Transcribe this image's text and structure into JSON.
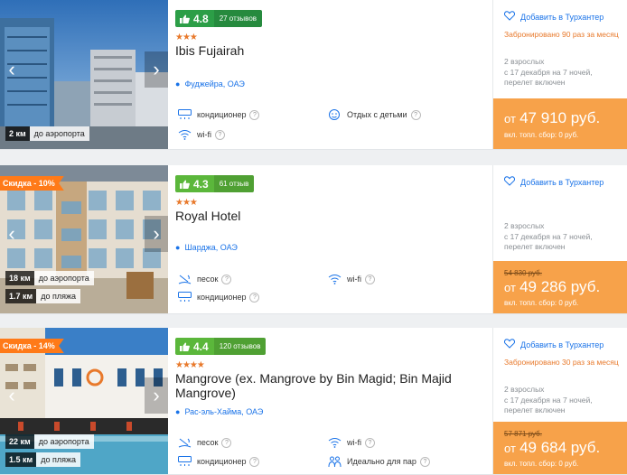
{
  "hotels": [
    {
      "rating": "4.8",
      "reviews": "27 отзывов",
      "stars": "★★★",
      "name": "Ibis Fujairah",
      "location": "Фуджейра, ОАЭ",
      "distances": [
        {
          "km": "2 км",
          "label": "до аэропорта"
        }
      ],
      "amenities": [
        {
          "icon": "air-conditioner-icon",
          "label": "кондиционер"
        },
        {
          "icon": "kids-icon",
          "label": "Отдых с детьми"
        },
        {
          "icon": "wifi-icon",
          "label": "wi-fi"
        }
      ],
      "favorite": "Добавить в Турхантер",
      "booked": "Забронировано 90 раз за месяц",
      "details": [
        "2 взрослых",
        "с 17 декабря на 7 ночей,",
        "перелет включен"
      ],
      "price_from": "от",
      "price": "47 910 руб.",
      "tax": "вкл. топл. сбор: 0 руб."
    },
    {
      "discount": "Скидка - 10%",
      "rating": "4.3",
      "reviews": "61 отзыв",
      "stars": "★★★",
      "name": "Royal Hotel",
      "location": "Шарджа, ОАЭ",
      "distances": [
        {
          "km": "18 км",
          "label": "до аэропорта"
        },
        {
          "km": "1.7 км",
          "label": "до пляжа"
        }
      ],
      "amenities": [
        {
          "icon": "sand-icon",
          "label": "песок"
        },
        {
          "icon": "wifi-icon",
          "label": "wi-fi"
        },
        {
          "icon": "air-conditioner-icon",
          "label": "кондиционер"
        }
      ],
      "favorite": "Добавить в Турхантер",
      "details": [
        "2 взрослых",
        "с 17 декабря на 7 ночей,",
        "перелет включен"
      ],
      "old_price": "54 830 руб.",
      "price_from": "от",
      "price": "49 286 руб.",
      "tax": "вкл. топл. сбор: 0 руб."
    },
    {
      "discount": "Скидка - 14%",
      "rating": "4.4",
      "reviews": "120 отзывов",
      "stars": "★★★★",
      "name": "Mangrove (ex. Mangrove by Bin Magid; Bin Majid Mangrove)",
      "location": "Рас-эль-Хайма, ОАЭ",
      "distances": [
        {
          "km": "22 км",
          "label": "до аэропорта"
        },
        {
          "km": "1.5 км",
          "label": "до пляжа"
        }
      ],
      "amenities": [
        {
          "icon": "sand-icon",
          "label": "песок"
        },
        {
          "icon": "wifi-icon",
          "label": "wi-fi"
        },
        {
          "icon": "air-conditioner-icon",
          "label": "кондиционер"
        },
        {
          "icon": "couple-icon",
          "label": "Идеально для пар"
        }
      ],
      "favorite": "Добавить в Турхантер",
      "booked": "Забронировано 30 раз за месяц",
      "details": [
        "2 взрослых",
        "с 17 декабря на 7 ночей,",
        "перелет включен"
      ],
      "old_price": "57 871 руб.",
      "price_from": "от",
      "price": "49 684 руб.",
      "tax": "вкл. топл. сбор: 0 руб."
    }
  ],
  "colors": {
    "accent": "#1a73e8",
    "price_bg": "#f7a24a",
    "rating_dark": "#2c9e47",
    "rating_light": "#5bb73b",
    "orange": "#e8792b"
  }
}
